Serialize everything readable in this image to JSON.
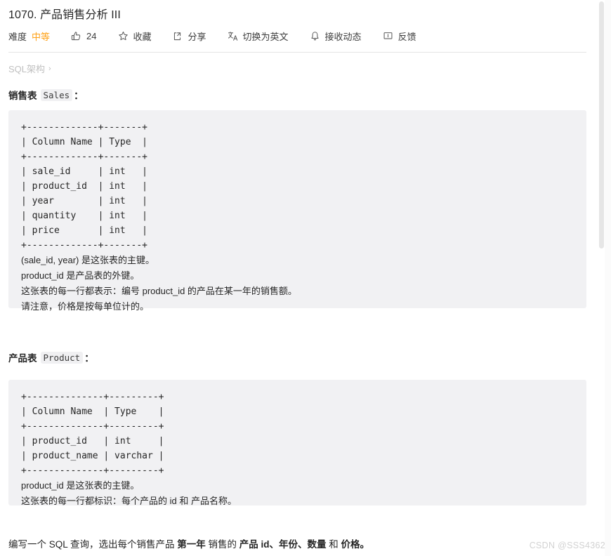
{
  "problem": {
    "title": "1070. 产品销售分析 III",
    "difficulty_label": "难度",
    "difficulty_value": "中等",
    "difficulty_color": "#ffa116"
  },
  "toolbar": {
    "likes_count": "24",
    "favorite_label": "收藏",
    "share_label": "分享",
    "translate_label": "切换为英文",
    "subscribe_label": "接收动态",
    "feedback_label": "反馈"
  },
  "breadcrumb": {
    "label": "SQL架构",
    "separator": "›"
  },
  "sections": [
    {
      "heading_text": "销售表",
      "heading_code": "Sales",
      "heading_colon": "：",
      "code": "+-------------+-------+\n| Column Name | Type  |\n+-------------+-------+\n| sale_id     | int   |\n| product_id  | int   |\n| year        | int   |\n| quantity    | int   |\n| price       | int   |\n+-------------+-------+",
      "notes": [
        "(sale_id, year) 是这张表的主键。",
        "product_id 是产品表的外键。",
        "这张表的每一行都表示：编号 product_id 的产品在某一年的销售额。",
        "请注意，价格是按每单位计的。"
      ]
    },
    {
      "heading_text": "产品表",
      "heading_code": "Product",
      "heading_colon": "：",
      "code": "+--------------+---------+\n| Column Name  | Type    |\n+--------------+---------+\n| product_id   | int     |\n| product_name | varchar |\n+--------------+---------+",
      "notes": [
        "product_id 是这张表的主键。",
        "这张表的每一行都标识：每个产品的 id 和 产品名称。"
      ]
    }
  ],
  "question": {
    "part1": "编写一个 SQL 查询，选出每个销售产品 ",
    "bold1": "第一年",
    "part2": " 销售的 ",
    "bold2": "产品 id、年份、数量",
    "part3": " 和 ",
    "bold3": "价格。"
  },
  "watermark": "CSDN @SSS4362"
}
